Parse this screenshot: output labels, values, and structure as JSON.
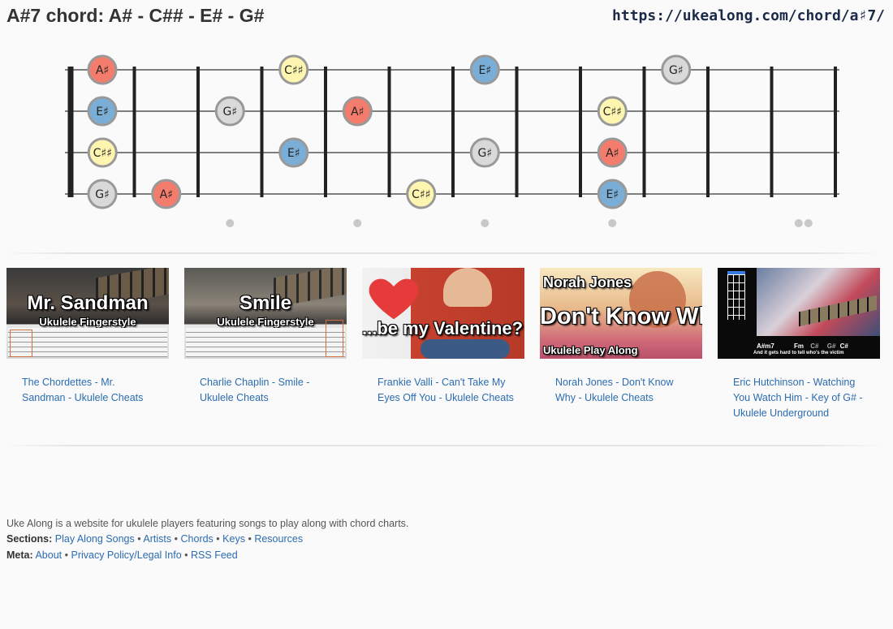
{
  "header": {
    "title": "A#7 chord: A# - C## - E# - G#",
    "url": "https://ukealong.com/chord/a♯7/"
  },
  "fretboard": {
    "strings": 4,
    "frets": 12,
    "marker_frets": [
      3,
      5,
      7,
      9
    ],
    "double_marker_fret": 12,
    "colors": {
      "root": "#f47c6c",
      "third": "#fef6b0",
      "fifth": "#7aaed6",
      "seventh": "#d9d9d9"
    },
    "notes": [
      {
        "string": 1,
        "fret": 0,
        "label": "A♯",
        "role": "root"
      },
      {
        "string": 1,
        "fret": 4,
        "label": "C♯♯",
        "role": "third"
      },
      {
        "string": 1,
        "fret": 7,
        "label": "E♯",
        "role": "fifth"
      },
      {
        "string": 1,
        "fret": 10,
        "label": "G♯",
        "role": "seventh"
      },
      {
        "string": 2,
        "fret": 0,
        "label": "E♯",
        "role": "fifth"
      },
      {
        "string": 2,
        "fret": 3,
        "label": "G♯",
        "role": "seventh"
      },
      {
        "string": 2,
        "fret": 5,
        "label": "A♯",
        "role": "root"
      },
      {
        "string": 2,
        "fret": 9,
        "label": "C♯♯",
        "role": "third"
      },
      {
        "string": 3,
        "fret": 1,
        "label": "C♯♯",
        "role": "third"
      },
      {
        "string": 3,
        "fret": 4,
        "label": "E♯",
        "role": "fifth"
      },
      {
        "string": 3,
        "fret": 7,
        "label": "G♯",
        "role": "seventh"
      },
      {
        "string": 3,
        "fret": 9,
        "label": "A♯",
        "role": "root"
      },
      {
        "string": 4,
        "fret": 0,
        "label": "G♯",
        "role": "seventh"
      },
      {
        "string": 4,
        "fret": 2,
        "label": "A♯",
        "role": "root"
      },
      {
        "string": 4,
        "fret": 6,
        "label": "C♯♯",
        "role": "third"
      },
      {
        "string": 4,
        "fret": 9,
        "label": "E♯",
        "role": "fifth"
      }
    ]
  },
  "videos": [
    {
      "thumb_line1": "Mr. Sandman",
      "thumb_line2": "Ukulele Fingerstyle",
      "title": "The Chordettes - Mr. Sandman - Ukulele Cheats"
    },
    {
      "thumb_line1": "Smile",
      "thumb_line2": "Ukulele Fingerstyle",
      "title": "Charlie Chaplin - Smile - Ukulele Cheats"
    },
    {
      "thumb_line1": "...be my Valentine?",
      "thumb_line2": "",
      "title": "Frankie Valli - Can't Take My Eyes Off You - Ukulele Cheats"
    },
    {
      "thumb_line0": "Norah Jones",
      "thumb_line1": "Don't Know Why",
      "thumb_line2": "Ukulele Play Along",
      "title": "Norah Jones - Don't Know Why - Ukulele Cheats"
    },
    {
      "thumb_chords": [
        "A#m7",
        "Fm",
        "C#",
        "G#",
        "C#"
      ],
      "thumb_lyric": "And it gets hard to tell who's the victim",
      "title": "Eric Hutchinson - Watching You Watch Him - Key of G# - Ukulele Underground"
    }
  ],
  "footer": {
    "description": "Uke Along is a website for ukulele players featuring songs to play along with chord charts.",
    "sections_label": "Sections:",
    "sections": [
      "Play Along Songs",
      "Artists",
      "Chords",
      "Keys",
      "Resources"
    ],
    "meta_label": "Meta:",
    "meta": [
      "About",
      "Privacy Policy/Legal Info",
      "RSS Feed"
    ],
    "separator": "•"
  }
}
